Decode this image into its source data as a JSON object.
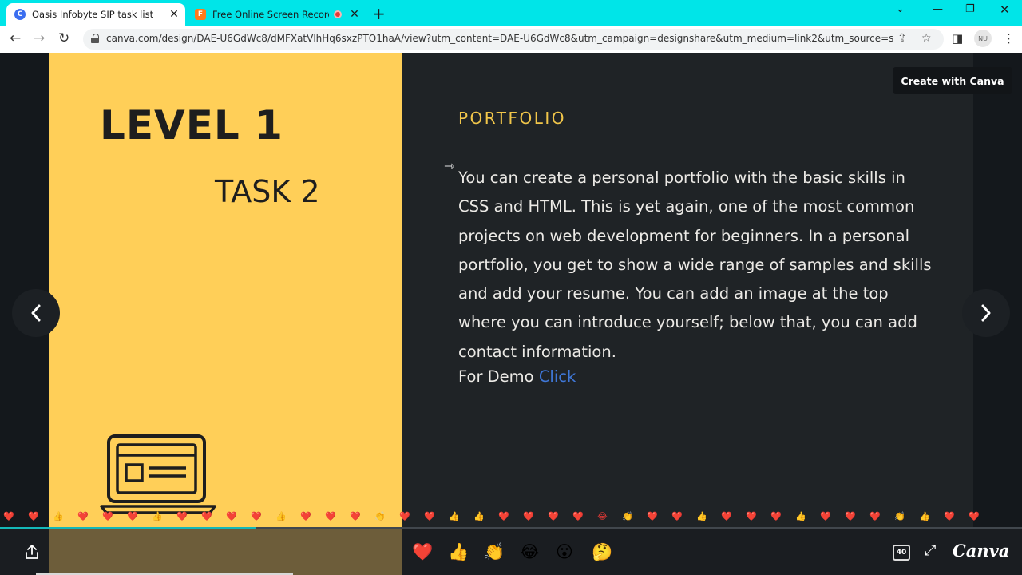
{
  "browser": {
    "tabs": [
      {
        "title": "Oasis Infobyte SIP task list",
        "favicon": "C",
        "active": true
      },
      {
        "title": "Free Online Screen Recorder",
        "favicon": "F",
        "active": false
      }
    ],
    "url": "canva.com/design/DAE-U6GdWc8/dMFXatVlhHq6sxzPTO1haA/view?utm_content=DAE-U6GdWc8&utm_campaign=designshare&utm_medium=link2&utm_source=sha...",
    "profile_initials": "NU",
    "icons": [
      "back-arrow-icon",
      "forward-arrow-icon",
      "reload-icon",
      "lock-icon",
      "share-icon",
      "star-icon",
      "sidebar-icon",
      "kebab-menu-icon"
    ]
  },
  "slide": {
    "level": "LEVEL 1",
    "task": "TASK 2",
    "section_title": "PORTFOLIO",
    "body": "You can create a personal portfolio with the basic skills in CSS and HTML. This is yet again, one of the most common projects on web development for beginners. In a personal portfolio, you get to show a wide range of samples and skills and add your resume. You can add an image at the top where you can introduce yourself; below that, you can add contact information.",
    "demo_label": "For Demo",
    "demo_link": "Click",
    "colors": {
      "left_panel": "#ffcf58",
      "right_panel": "#1f2326",
      "accent": "#f1c64a",
      "link": "#3f77d8"
    }
  },
  "viewer": {
    "create_button": "Create with Canva",
    "prev_label": "‹",
    "next_label": "›",
    "progress": 0.25,
    "page_count": "40",
    "logo": "Canva",
    "reactions": [
      "❤️",
      "👍",
      "👏",
      "😂",
      "😮",
      "🤔"
    ]
  }
}
